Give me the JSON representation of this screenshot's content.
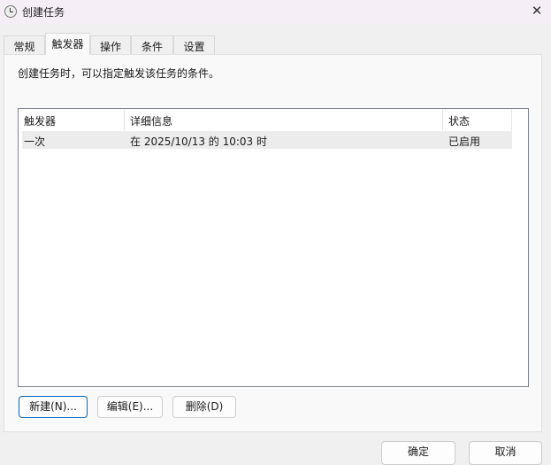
{
  "window": {
    "title": "创建任务",
    "close": "✕"
  },
  "tabs": [
    {
      "label": "常规"
    },
    {
      "label": "触发器"
    },
    {
      "label": "操作"
    },
    {
      "label": "条件"
    },
    {
      "label": "设置"
    }
  ],
  "description": "创建任务时，可以指定触发该任务的条件。",
  "table": {
    "columns": [
      "触发器",
      "详细信息",
      "状态"
    ],
    "rows": [
      {
        "trigger": "一次",
        "details": "在 2025/10/13 的 10:03 时",
        "status": "已启用"
      }
    ]
  },
  "buttons": {
    "new": "新建(N)...",
    "edit": "编辑(E)...",
    "delete": "删除(D)",
    "ok": "确定",
    "cancel": "取消"
  }
}
